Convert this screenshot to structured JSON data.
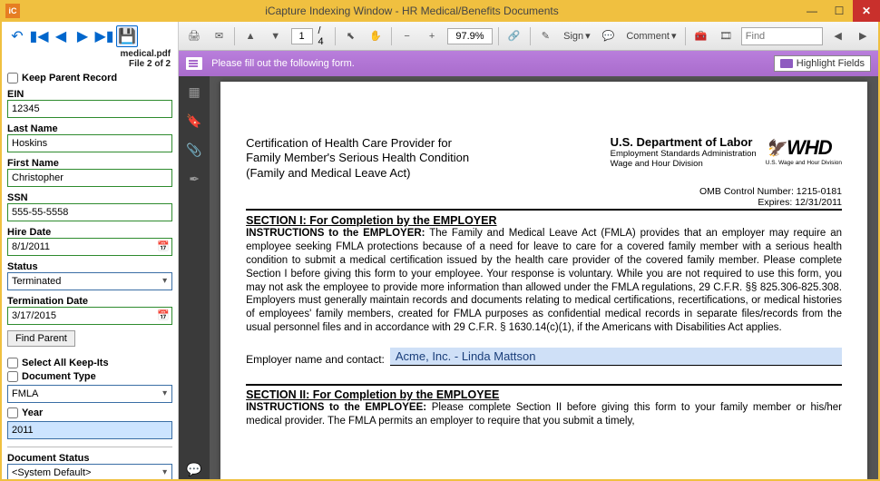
{
  "window": {
    "app_icon": "iC",
    "title": "iCapture Indexing Window - HR Medical/Benefits Documents"
  },
  "nav": {
    "filename": "medical.pdf",
    "filecount": "File 2 of 2"
  },
  "keep_parent_label": "Keep Parent Record",
  "fields": {
    "ein_label": "EIN",
    "ein_value": "12345",
    "lastname_label": "Last Name",
    "lastname_value": "Hoskins",
    "firstname_label": "First Name",
    "firstname_value": "Christopher",
    "ssn_label": "SSN",
    "ssn_value": "555-55-5558",
    "hiredate_label": "Hire Date",
    "hiredate_value": "8/1/2011",
    "status_label": "Status",
    "status_value": "Terminated",
    "termdate_label": "Termination Date",
    "termdate_value": "3/17/2015"
  },
  "find_parent_label": "Find Parent",
  "select_all_label": "Select All Keep-Its",
  "doc_type_label": "Document Type",
  "doc_type_value": "FMLA",
  "year_label": "Year",
  "year_value": "2011",
  "doc_status_label": "Document Status",
  "doc_status_value": "<System Default>",
  "pdf_toolbar": {
    "page_current": "1",
    "page_total": "/  4",
    "zoom": "97.9%",
    "sign_label": "Sign",
    "comment_label": "Comment",
    "find_placeholder": "Find"
  },
  "formbar": {
    "msg": "Please fill out the following form.",
    "highlight_label": "Highlight Fields"
  },
  "doc": {
    "cert_title_l1": "Certification of Health Care Provider for",
    "cert_title_l2": "Family Member's Serious Health Condition",
    "cert_title_l3": "(Family and Medical Leave Act)",
    "dept": "U.S. Department of Labor",
    "dept_sub1": "Employment Standards Administration",
    "dept_sub2": "Wage and Hour Division",
    "whd_logo": "WHD",
    "whd_sub": "U.S. Wage and Hour Division",
    "omb_l1": "OMB Control Number: 1215-0181",
    "omb_l2": "Expires: 12/31/2011",
    "section1": "SECTION I:  For Completion by the EMPLOYER",
    "instr1_lead": "INSTRUCTIONS to the EMPLOYER:",
    "instr1_body": " The Family and Medical Leave Act (FMLA) provides that an employer may require an employee seeking FMLA protections because of a need for leave to care for a covered family member with a serious health condition to submit a medical certification issued by the health care provider of the covered family member.  Please complete Section I before giving this form to your employee.  Your response is voluntary. While you are not required to use this form, you may not ask the employee to provide more information than allowed under the FMLA regulations, 29 C.F.R. §§ 825.306-825.308.  Employers must generally maintain records and documents relating to medical certifications, recertifications, or medical histories of employees' family members, created for FMLA purposes as confidential medical records in separate files/records from the usual personnel files and in accordance with 29 C.F.R. § 1630.14(c)(1), if the Americans with Disabilities Act applies.",
    "emp_contact_label": "Employer name and contact:",
    "emp_contact_value": "Acme, Inc. - Linda Mattson",
    "section2": "SECTION II:  For Completion by the EMPLOYEE",
    "instr2_lead": "INSTRUCTIONS to the EMPLOYEE:",
    "instr2_body": " Please complete Section II before giving this form to your family member or his/her medical provider.  The FMLA permits an employer to require that you submit a timely,"
  }
}
